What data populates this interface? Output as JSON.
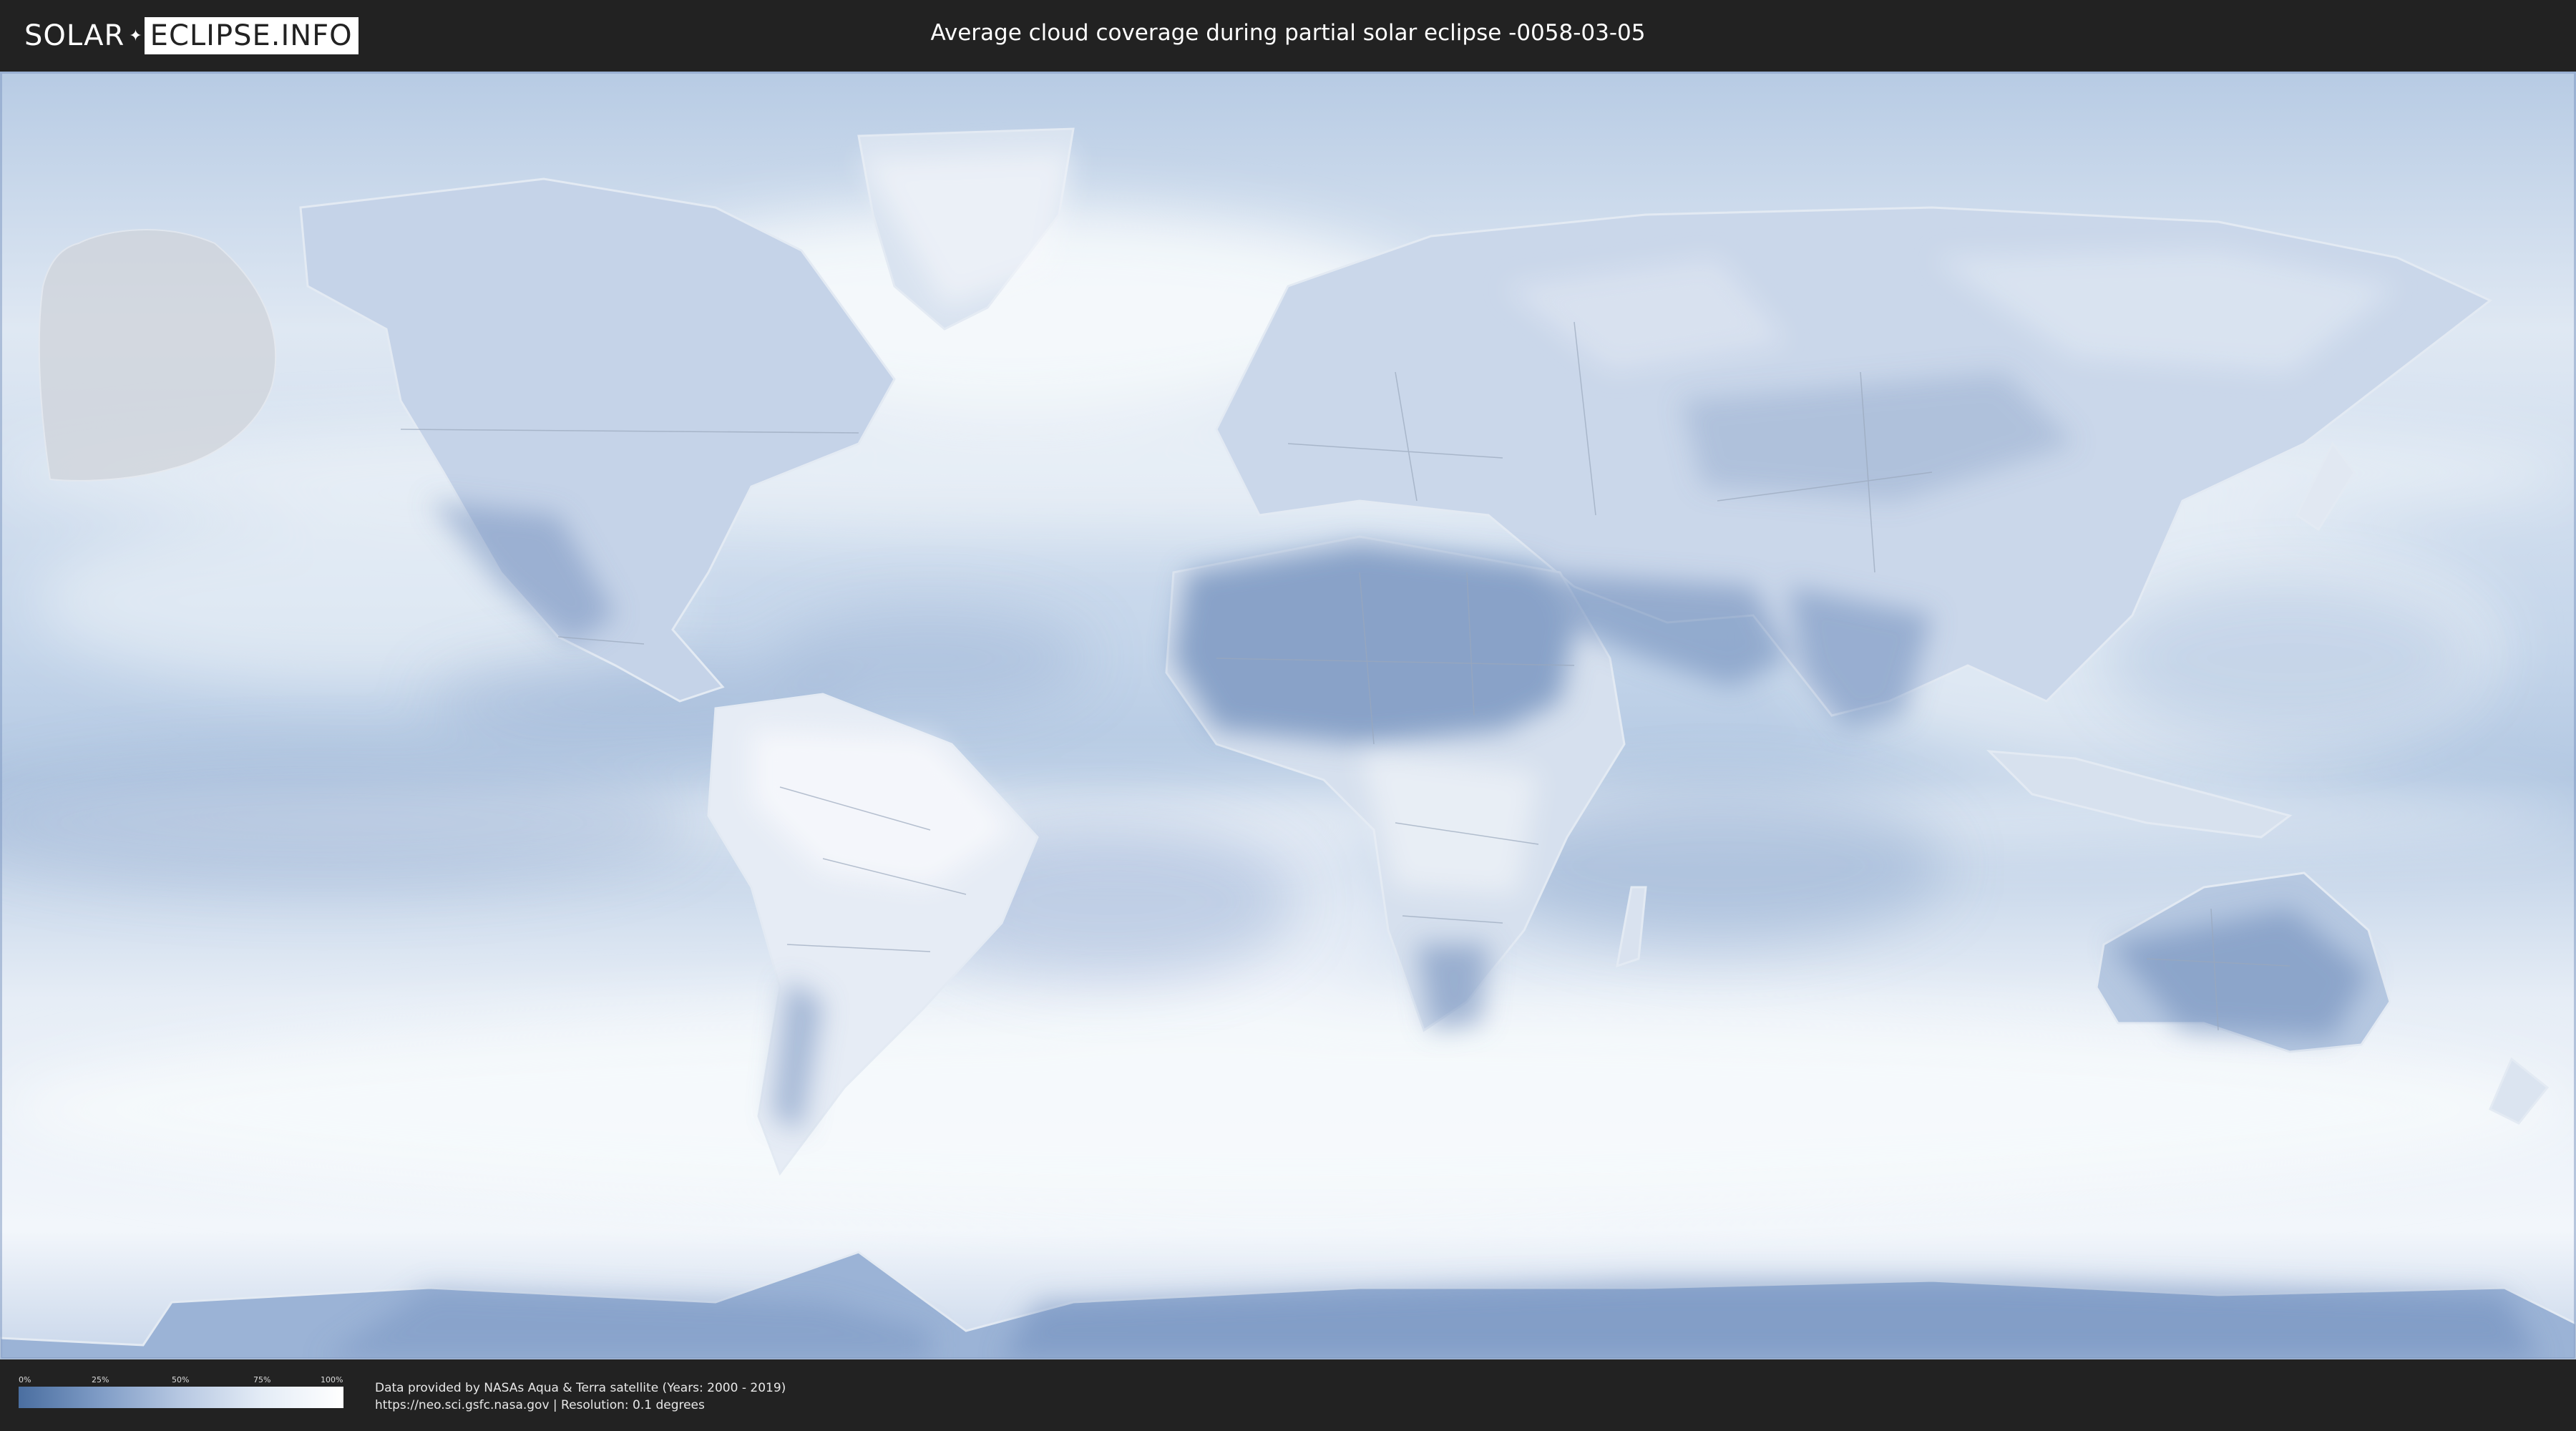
{
  "header": {
    "logo": {
      "left_text": "SOLAR",
      "right_text": "ECLIPSE.INFO"
    },
    "title": "Average cloud coverage during partial solar eclipse -0058-03-05"
  },
  "legend": {
    "ticks": [
      "0%",
      "25%",
      "50%",
      "75%",
      "100%"
    ],
    "scale": "cloud coverage from 0% to 100%",
    "colors": {
      "low": "#4a6ea0",
      "mid": "#b7c8e2",
      "high": "#ffffff"
    }
  },
  "footer": {
    "credit_line_1": "Data provided by NASAs Aqua & Terra satellite (Years: 2000 - 2019)",
    "credit_line_2": "https://neo.sci.gsfc.nasa.gov | Resolution: 0.1 degrees"
  },
  "map": {
    "projection": "equirectangular",
    "ocean_color": "#bccfe6",
    "cloud_color": "#f4f7fb",
    "clear_land_color": "#6f8dbb",
    "eclipse_zone_color": "#cfd3da"
  }
}
